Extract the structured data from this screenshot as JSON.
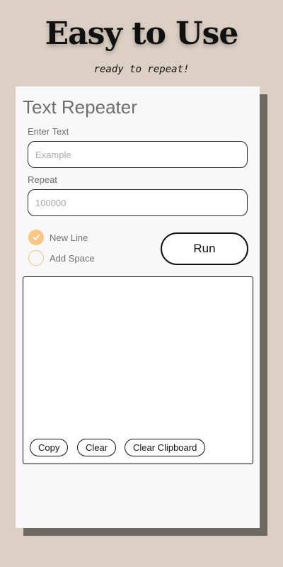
{
  "promo": {
    "title": "Easy to Use",
    "subtitle": "ready to repeat!"
  },
  "app": {
    "title": "Text Repeater",
    "text_field": {
      "label": "Enter Text",
      "placeholder": "Example",
      "value": ""
    },
    "repeat_field": {
      "label": "Repeat",
      "placeholder": "100000",
      "value": ""
    },
    "options": [
      {
        "label": "New Line",
        "checked": true
      },
      {
        "label": "Add Space",
        "checked": false
      }
    ],
    "run_label": "Run",
    "output": {
      "value": "",
      "buttons": {
        "copy": "Copy",
        "clear": "Clear",
        "clear_clipboard": "Clear Clipboard"
      }
    }
  },
  "colors": {
    "background": "#dccfc3",
    "card": "#f8f8f8",
    "card_shadow": "#6e6961",
    "accent": "#fac585",
    "label_gray": "#6f6f6f"
  },
  "icons": {
    "check": "check-icon"
  }
}
